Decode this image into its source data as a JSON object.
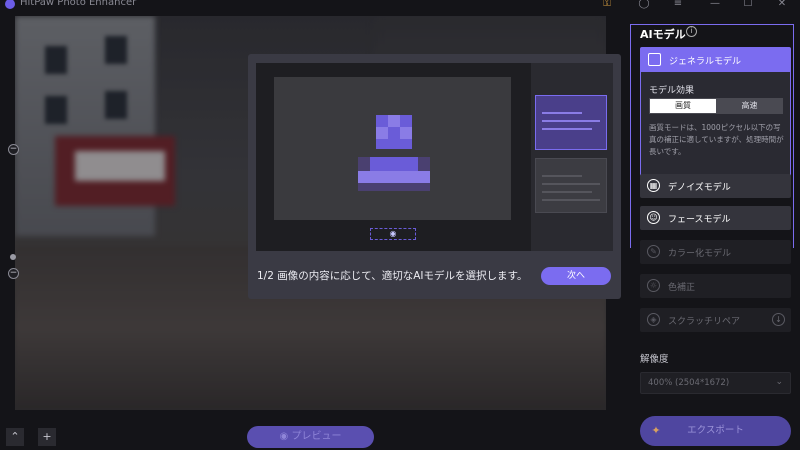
{
  "window": {
    "title": "HitPaw Photo Enhancer",
    "icons": {
      "cart": "cart-icon",
      "user": "user-icon",
      "menu": "menu-icon",
      "minimize": "minimize-icon",
      "maximize": "maximize-icon",
      "close": "close-icon"
    }
  },
  "canvas": {
    "zoom_out_label": "−",
    "zoom_in_label": "−"
  },
  "tutorial": {
    "step_text": "1/2 画像の内容に応じて、適切なAIモデルを選択します。",
    "next_label": "次へ"
  },
  "bottom_bar": {
    "collapse_label": "⌃",
    "add_label": "+",
    "preview_label": "プレビュー"
  },
  "panel": {
    "ai_model_title": "AIモデル",
    "info_icon": "i",
    "general_model": {
      "label": "ジェネラルモデル",
      "effect_label": "モデル効果",
      "quality_label": "画質",
      "speed_label": "高速",
      "selected": "画質",
      "description": "画質モードは、1000ピクセル以下の写真の補正に適していますが、処理時間が長いです。"
    },
    "models": [
      {
        "label": "デノイズモデル",
        "icon": "denoise-icon"
      },
      {
        "label": "フェースモデル",
        "icon": "face-icon"
      },
      {
        "label": "カラー化モデル",
        "icon": "colorize-icon"
      },
      {
        "label": "色補正",
        "icon": "color-correct-icon"
      },
      {
        "label": "スクラッチリペア",
        "icon": "scratch-repair-icon"
      }
    ],
    "resolution_label": "解像度",
    "resolution_value": "400% (2504*1672)",
    "export_label": "エクスポート"
  },
  "colors": {
    "accent": "#7b6cf0",
    "panel_bg": "#141418",
    "dialog_bg": "#3a3a44"
  }
}
